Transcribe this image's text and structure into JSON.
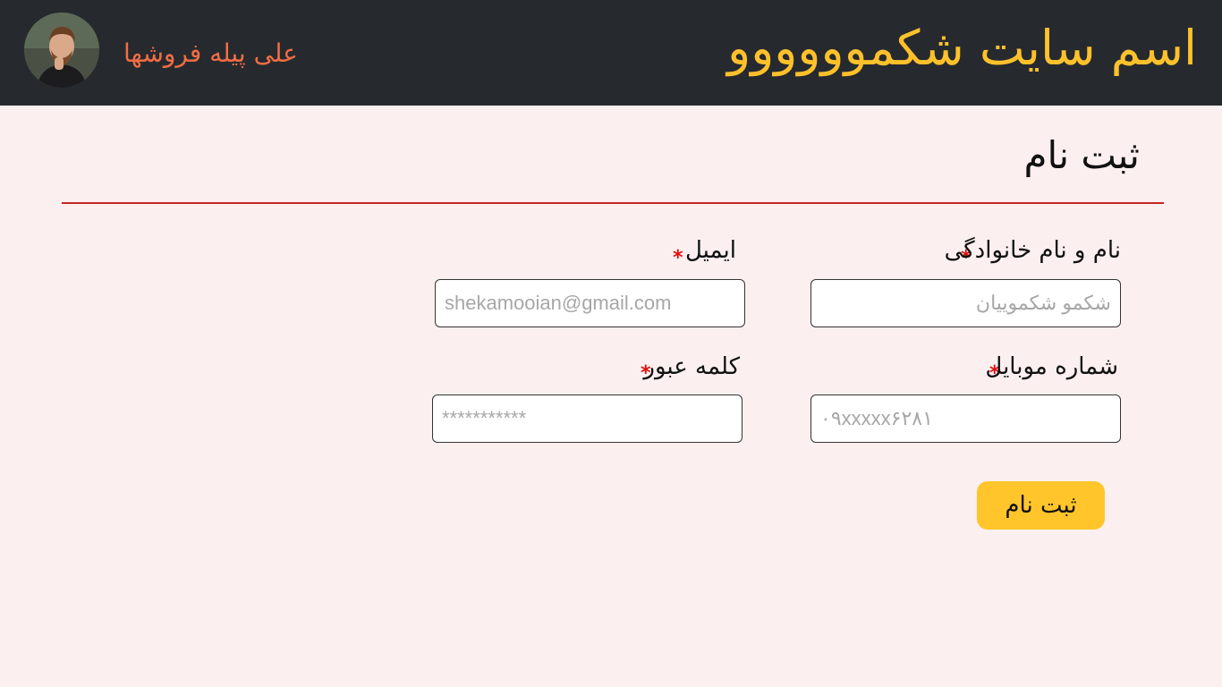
{
  "header": {
    "site_title": "اسم سایت شکموووووو",
    "user_name": "علی پیله فروشها"
  },
  "form": {
    "title": "ثبت نام",
    "fields": {
      "fullname": {
        "label": "نام و نام خانوادگی",
        "placeholder": "شکمو شکموییان",
        "value": "",
        "required": "*"
      },
      "email": {
        "label": "ایمیل",
        "placeholder": "shekamooian@gmail.com",
        "value": "",
        "required": "*"
      },
      "mobile": {
        "label": "شماره موبایل",
        "placeholder": "۰۹xxxxx۶۲۸۱",
        "value": "",
        "required": "*"
      },
      "password": {
        "label": "کلمه عبور",
        "placeholder": "***********",
        "value": "",
        "required": "*"
      }
    },
    "submit_label": "ثبت نام"
  },
  "colors": {
    "header_bg": "#262a2e",
    "accent": "#ffc12b",
    "user_name": "#f26d45",
    "divider": "#c42422",
    "required": "#e01010",
    "page_bg": "#fbf0ef"
  }
}
